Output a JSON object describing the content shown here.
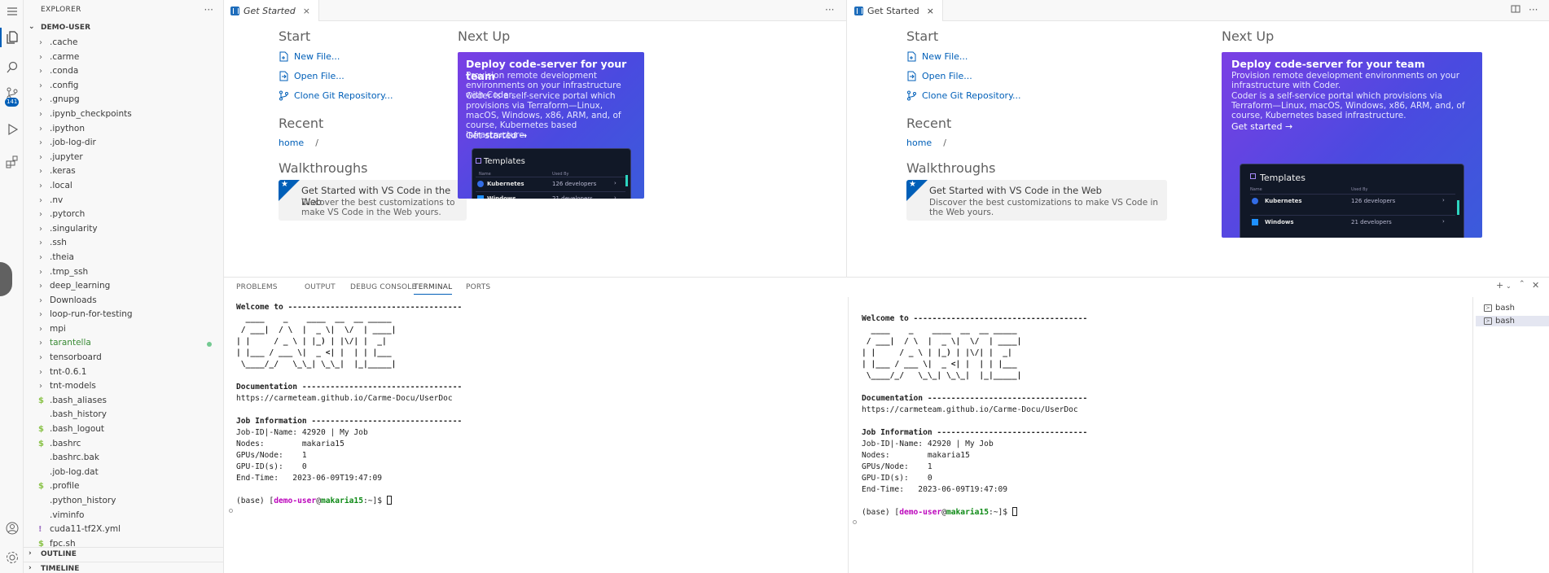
{
  "activity_bar": {
    "badge": "141",
    "icons": [
      "menu-icon",
      "files-icon",
      "search-icon",
      "source-control-icon",
      "run-debug-icon",
      "extensions-icon",
      "account-icon",
      "gear-icon"
    ]
  },
  "sidebar": {
    "title": "EXPLORER",
    "more": "···",
    "folder": "DEMO-USER",
    "items": [
      {
        "name": ".cache",
        "kind": "folder"
      },
      {
        "name": ".carme",
        "kind": "folder"
      },
      {
        "name": ".conda",
        "kind": "folder"
      },
      {
        "name": ".config",
        "kind": "folder"
      },
      {
        "name": ".gnupg",
        "kind": "folder"
      },
      {
        "name": ".ipynb_checkpoints",
        "kind": "folder"
      },
      {
        "name": ".ipython",
        "kind": "folder"
      },
      {
        "name": ".job-log-dir",
        "kind": "folder"
      },
      {
        "name": ".jupyter",
        "kind": "folder"
      },
      {
        "name": ".keras",
        "kind": "folder"
      },
      {
        "name": ".local",
        "kind": "folder"
      },
      {
        "name": ".nv",
        "kind": "folder"
      },
      {
        "name": ".pytorch",
        "kind": "folder"
      },
      {
        "name": ".singularity",
        "kind": "folder"
      },
      {
        "name": ".ssh",
        "kind": "folder"
      },
      {
        "name": ".theia",
        "kind": "folder"
      },
      {
        "name": ".tmp_ssh",
        "kind": "folder"
      },
      {
        "name": "deep_learning",
        "kind": "folder"
      },
      {
        "name": "Downloads",
        "kind": "folder"
      },
      {
        "name": "loop-run-for-testing",
        "kind": "folder"
      },
      {
        "name": "mpi",
        "kind": "folder"
      },
      {
        "name": "tarantella",
        "kind": "folder",
        "modified": true
      },
      {
        "name": "tensorboard",
        "kind": "folder"
      },
      {
        "name": "tnt-0.6.1",
        "kind": "folder"
      },
      {
        "name": "tnt-models",
        "kind": "folder"
      },
      {
        "name": ".bash_aliases",
        "kind": "shell"
      },
      {
        "name": ".bash_history",
        "kind": "file"
      },
      {
        "name": ".bash_logout",
        "kind": "shell"
      },
      {
        "name": ".bashrc",
        "kind": "shell"
      },
      {
        "name": ".bashrc.bak",
        "kind": "file"
      },
      {
        "name": ".job-log.dat",
        "kind": "file"
      },
      {
        "name": ".profile",
        "kind": "shell"
      },
      {
        "name": ".python_history",
        "kind": "file"
      },
      {
        "name": ".viminfo",
        "kind": "file"
      },
      {
        "name": "cuda11-tf2X.yml",
        "kind": "yaml"
      },
      {
        "name": "fpc.sh",
        "kind": "shell"
      }
    ],
    "outline": "OUTLINE",
    "timeline": "TIMELINE"
  },
  "editors": {
    "left": {
      "tab_title": "Get Started",
      "more": "···",
      "start_heading": "Start",
      "links": [
        "New File...",
        "Open File...",
        "Clone Git Repository..."
      ],
      "recent_heading": "Recent",
      "recent_item": "home",
      "recent_path": "/",
      "walkthroughs_heading": "Walkthroughs",
      "walk_title": "Get Started with VS Code in the Web",
      "walk_desc": "Discover the best customizations to make VS Code in the Web yours.",
      "next_heading": "Next Up",
      "promo_title": "Deploy code-server for your team",
      "promo_desc1": "Provision remote development environments on your infrastructure with Coder.",
      "promo_desc2": "Coder is a self-service portal which provisions via Terraform—Linux, macOS, Windows, x86, ARM, and, of course, Kubernetes based infrastructure.",
      "promo_link": "Get started →",
      "templates": {
        "title": "Templates",
        "col_name": "Name",
        "col_used": "Used By",
        "rows": [
          {
            "name": "Kubernetes",
            "used": "126 developers"
          },
          {
            "name": "Windows",
            "used": "21 developers"
          }
        ]
      }
    },
    "right": {
      "tab_title": "Get Started",
      "close": "×",
      "split_icon": "split-editor-icon",
      "more": "···"
    }
  },
  "panel": {
    "tabs": [
      "PROBLEMS",
      "OUTPUT",
      "DEBUG CONSOLE",
      "TERMINAL",
      "PORTS"
    ],
    "active_tab": "TERMINAL",
    "terminals": [
      "bash",
      "bash"
    ],
    "terminal_text": {
      "welcome": "Welcome to -------------------------------------",
      "art": [
        "  ____    _    ____  __  __ _____ ",
        " / ___|  / \\  |  _ \\|  \\/  | ____|",
        "| |     / _ \\ | |_) | |\\/| |  _|  ",
        "| |___ / ___ \\|  _ <| |  | | |___ ",
        " \\____/_/   \\_\\_| \\_\\_|  |_|_____|"
      ],
      "doc_header": "Documentation ----------------------------------",
      "doc_url": "https://carmeteam.github.io/Carme-Docu/UserDoc",
      "job_header": "Job Information --------------------------------",
      "job_lines": [
        "Job-ID|-Name: 42920 | My Job",
        "Nodes:        makaria15",
        "GPUs/Node:    1",
        "GPU-ID(s):    0",
        "End-Time:   2023-06-09T19:47:09"
      ],
      "prompt_base": "(base) [",
      "prompt_user": "demo-user",
      "prompt_at": "@",
      "prompt_host": "makaria15",
      "prompt_tail": ":~]$ "
    }
  }
}
